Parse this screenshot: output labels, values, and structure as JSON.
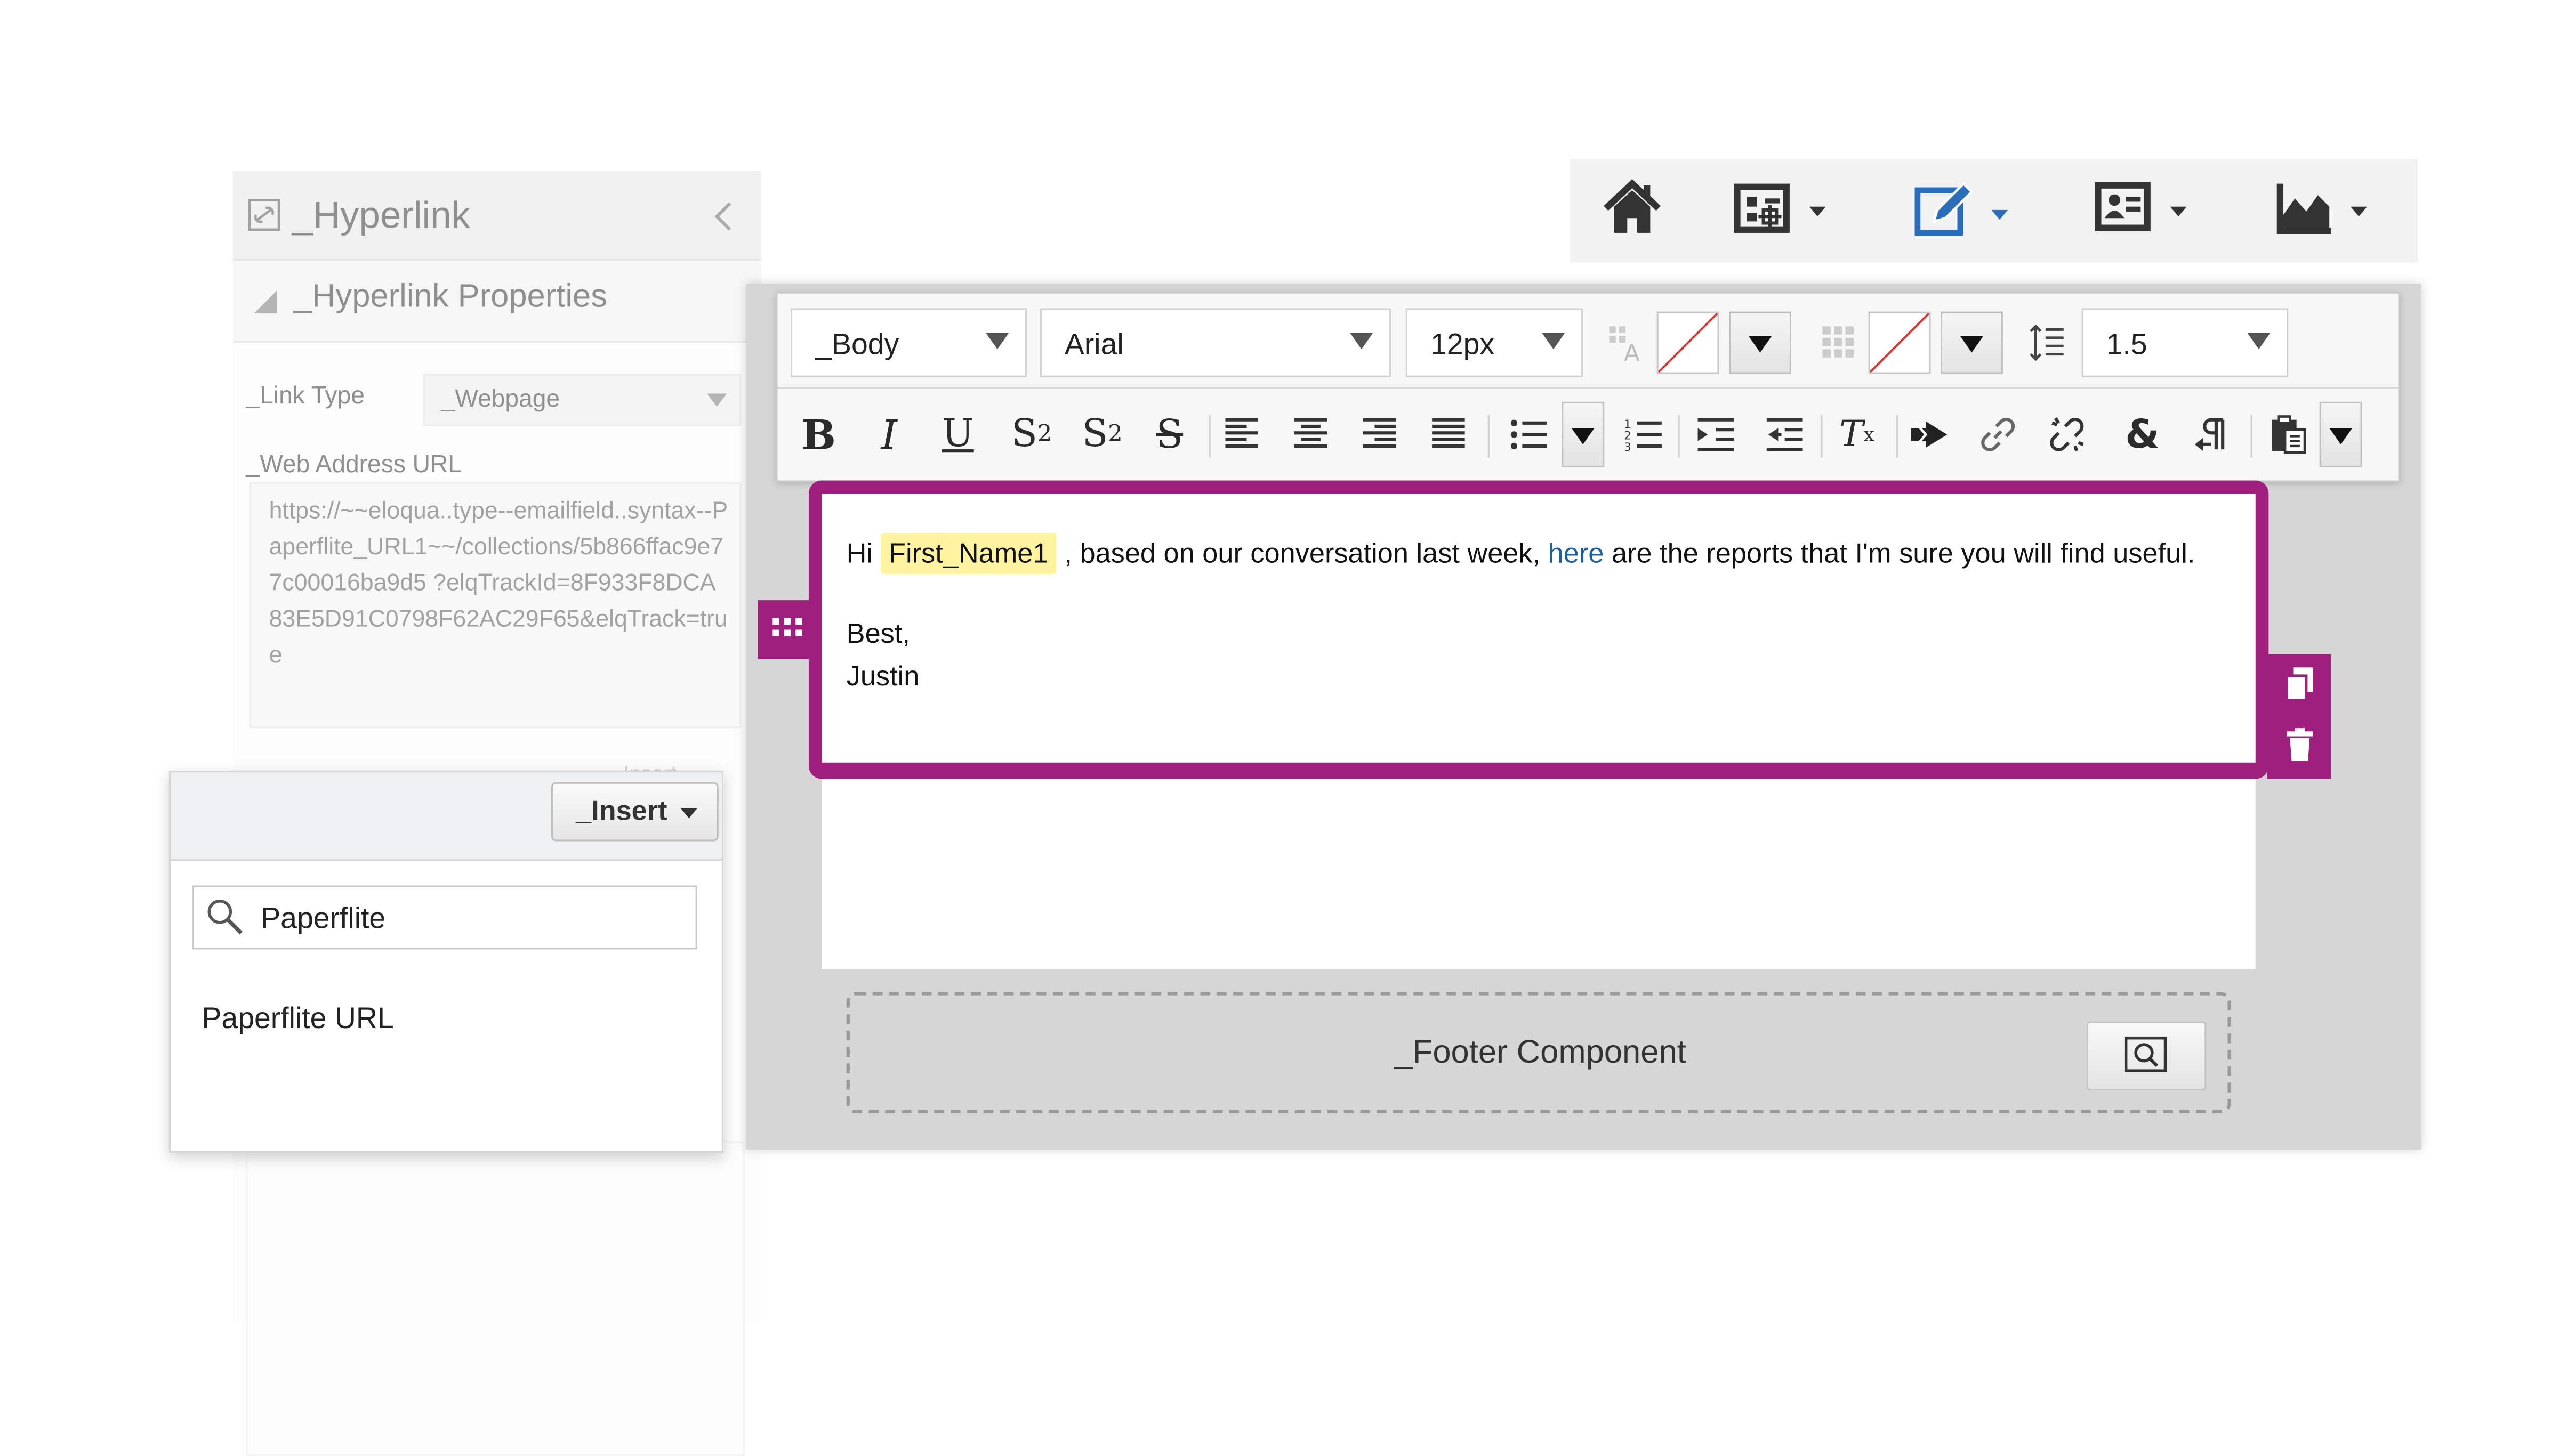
{
  "hyperlink_panel": {
    "title": "_Hyperlink",
    "section_title": "_Hyperlink Properties",
    "link_type_label": "_Link Type",
    "link_type_value": "_Webpage",
    "url_label": "_Web Address URL",
    "url_value": "https://~~eloqua..type--emailfield..syntax--Paperflite_URL1~~/collections/5b866ffac9e77c00016ba9d5 ?elqTrackId=8F933F8DCA83E5D91C0798F62AC29F65&elqTrack=true",
    "hidden_insert_label": "Insert"
  },
  "insert_popup": {
    "insert_button": "_Insert",
    "search_value": "Paperflite",
    "result_item": "Paperflite URL"
  },
  "topnav": {
    "icons": [
      "home-icon",
      "campaign-icon",
      "edit-pencil-icon",
      "contact-card-icon",
      "analytics-chart-icon"
    ],
    "accent_color": "#2a6ebb"
  },
  "toolbar": {
    "style_value": "_Body",
    "font_value": "Arial",
    "size_value": "12px",
    "line_height_value": "1.5",
    "format_icons": [
      "bold",
      "italic",
      "underline",
      "subscript",
      "superscript",
      "strikethrough",
      "align-left",
      "align-center",
      "align-right",
      "justify",
      "bulleted-list",
      "numbered-list",
      "indent",
      "outdent",
      "remove-format",
      "insert-field",
      "link",
      "unlink",
      "special-character",
      "paragraph-direction",
      "paste"
    ]
  },
  "content": {
    "greeting": "Hi",
    "field_token": "First_Name1",
    "text_before_link": ", based on our conversation last week,",
    "link_text": "here",
    "text_after_link": "are the reports that I'm sure you will find useful.",
    "signoff": "Best,",
    "signature": "Justin",
    "accent_color": "#9f1f7f"
  },
  "footer": {
    "label": "_Footer Component"
  }
}
